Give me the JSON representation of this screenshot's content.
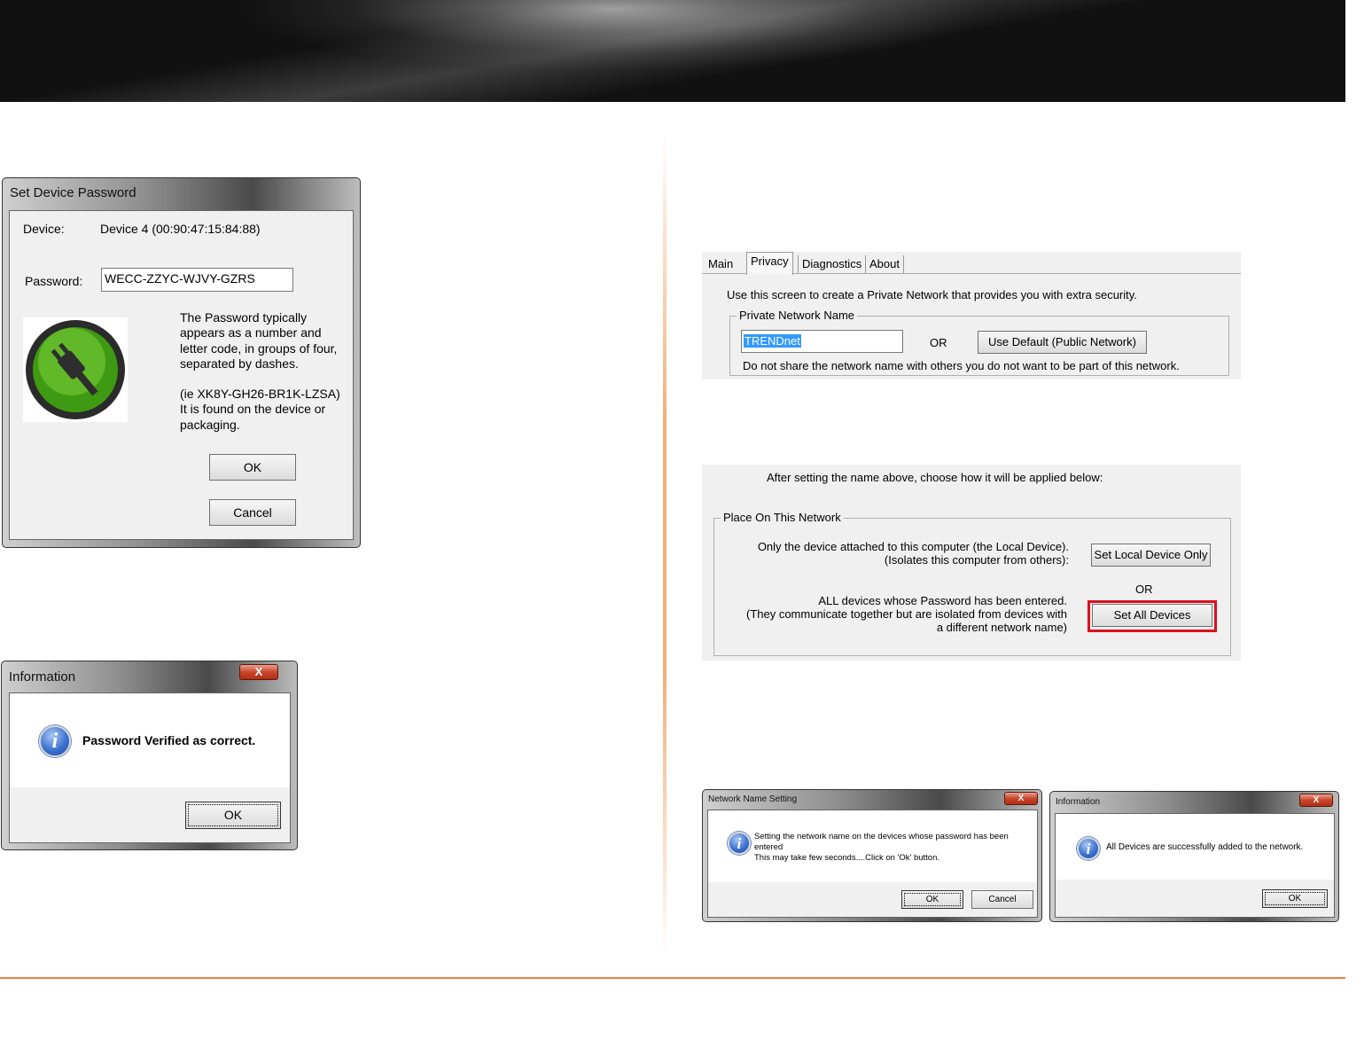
{
  "set_password_dialog": {
    "title": "Set Device Password",
    "device_label": "Device:",
    "device_value": "Device 4  (00:90:47:15:84:88)",
    "password_label": "Password:",
    "password_value": "WECC-ZZYC-WJVY-GZRS",
    "help_lines": [
      "The Password typically",
      "appears as a number and",
      "letter code, in groups of four,",
      "separated by dashes.",
      "",
      "(ie XK8Y-GH26-BR1K-LZSA)",
      "It is found on the device or",
      "packaging."
    ],
    "ok_label": "OK",
    "cancel_label": "Cancel",
    "icon": "green-plug-icon"
  },
  "info_dialog_1": {
    "title": "Information",
    "close_glyph": "X",
    "message": "Password Verified as correct.",
    "ok_label": "OK",
    "icon": "info-icon"
  },
  "privacy_panel": {
    "tabs": [
      "Main",
      "Privacy",
      "Diagnostics",
      "About"
    ],
    "active_tab": "Privacy",
    "intro": "Use this screen to create a Private Network that provides you with extra security.",
    "group_title": "Private Network Name",
    "network_name_value": "TRENDnet",
    "or_label": "OR",
    "use_default_label": "Use Default (Public Network)",
    "warning": "Do not share the network name with others you do not want to be part of this network."
  },
  "apply_panel": {
    "intro": "After setting the name above, choose how it will be applied below:",
    "group_title": "Place On This Network",
    "local_line1": "Only the device attached to this computer (the Local Device).",
    "local_line2": "(Isolates this computer from others):",
    "set_local_label": "Set Local Device Only",
    "or_label": "OR",
    "all_line1": "ALL devices whose Password has been entered.",
    "all_line2": "(They communicate together but are isolated from devices with",
    "all_line3": "a different network name)",
    "set_all_label": "Set All Devices",
    "highlight_color": "#e0101e"
  },
  "network_name_dialog": {
    "title": "Network Name Setting",
    "close_glyph": "X",
    "message_line1": "Setting the network name on the devices whose password has been",
    "message_line2": "entered",
    "message_line3": "This may take few seconds....Click on 'Ok' button.",
    "ok_label": "OK",
    "cancel_label": "Cancel"
  },
  "info_dialog_2": {
    "title": "Information",
    "close_glyph": "X",
    "message": "All Devices are successfully added to the network.",
    "ok_label": "OK"
  },
  "colors": {
    "accent_orange": "#e8823a",
    "highlight_red": "#e0101e",
    "selection_blue": "#3399ff"
  }
}
